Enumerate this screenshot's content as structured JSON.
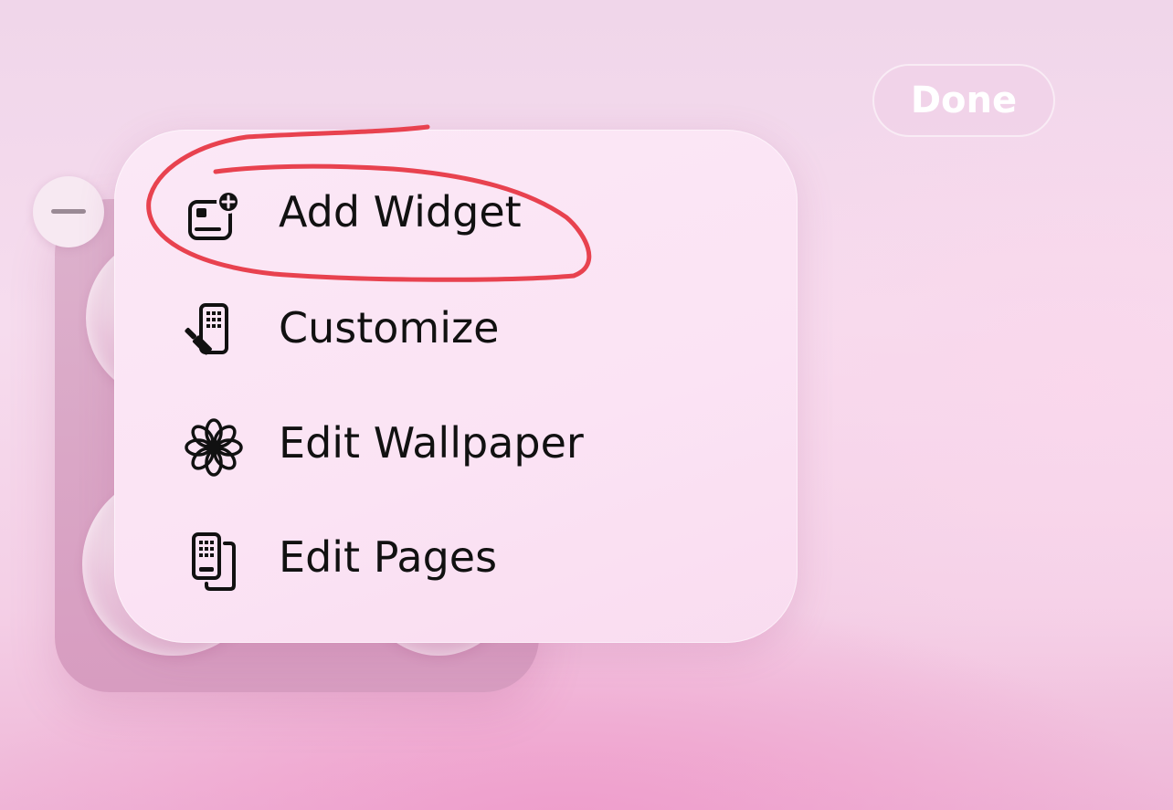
{
  "header": {
    "done_label": "Done"
  },
  "menu": {
    "items": [
      {
        "label": "Add Widget",
        "icon": "add-widget-icon"
      },
      {
        "label": "Customize",
        "icon": "customize-icon"
      },
      {
        "label": "Edit Wallpaper",
        "icon": "flower-icon"
      },
      {
        "label": "Edit Pages",
        "icon": "edit-pages-icon"
      }
    ]
  },
  "colors": {
    "annotation": "#e8424f",
    "menu_background": "#fbe5f5",
    "done_text": "#ffffff"
  }
}
